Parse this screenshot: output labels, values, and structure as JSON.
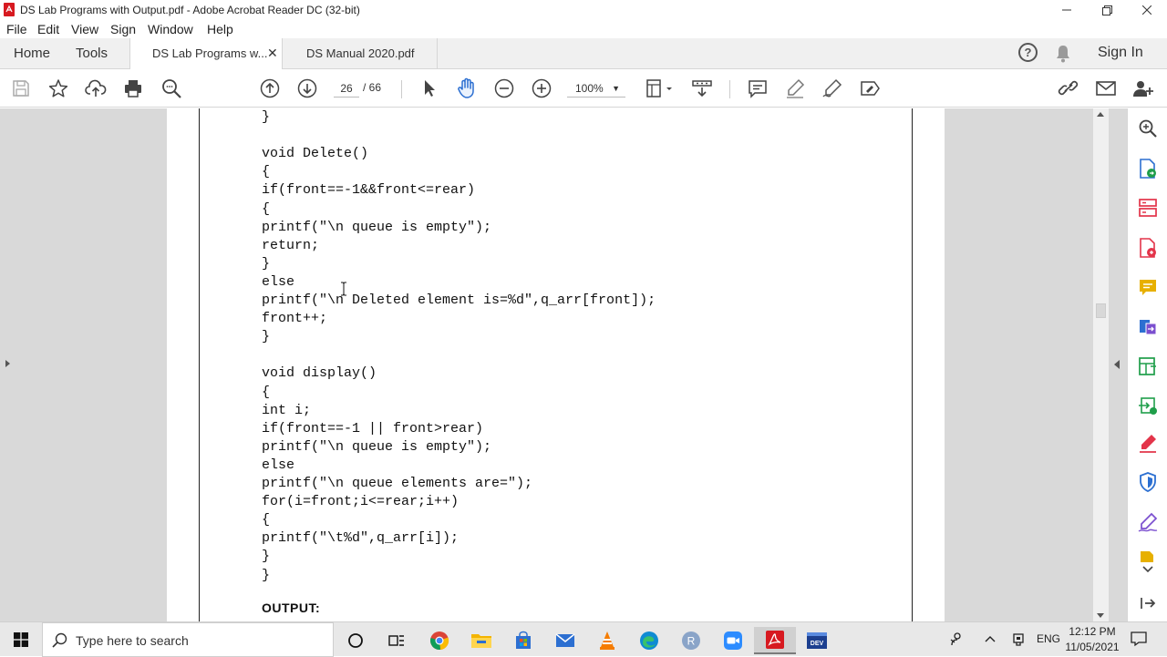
{
  "window": {
    "title": "DS Lab Programs with Output.pdf - Adobe Acrobat Reader DC (32-bit)"
  },
  "menu": [
    "File",
    "Edit",
    "View",
    "Sign",
    "Window",
    "Help"
  ],
  "tabs": {
    "home": "Home",
    "tools": "Tools",
    "documents": [
      {
        "label": "DS Lab Programs w...",
        "active": true,
        "close": "✕"
      },
      {
        "label": "DS Manual 2020.pdf",
        "active": false
      }
    ],
    "sign_in": "Sign In"
  },
  "toolbar": {
    "current_page": "26",
    "page_total": "/ 66",
    "zoom": "100%"
  },
  "document": {
    "code_lines": [
      "}",
      "",
      "void Delete()",
      "{",
      "if(front==-1&&front<=rear)",
      "{",
      "printf(\"\\n queue is empty\");",
      "return;",
      "}",
      "else",
      "printf(\"\\n Deleted element is=%d\",q_arr[front]);",
      "front++;",
      "}",
      "",
      "void display()",
      "{",
      "int i;",
      "if(front==-1 || front>rear)",
      "printf(\"\\n queue is empty\");",
      "else",
      "printf(\"\\n queue elements are=\");",
      "for(i=front;i<=rear;i++)",
      "{",
      "printf(\"\\t%d\",q_arr[i]);",
      "}",
      "}"
    ],
    "output_heading": "OUTPUT:"
  },
  "taskbar": {
    "search_placeholder": "Type here to search",
    "language": "ENG",
    "time": "12:12 PM",
    "date": "11/05/2021"
  },
  "colors": {
    "acrobat_red": "#d71920",
    "workspace_gray": "#d9d9d9",
    "tool_icon_green": "#1f9e4a",
    "tool_icon_blue": "#2c6fd1",
    "tool_icon_purple": "#7b4fcf",
    "tool_icon_yellow": "#e7b000",
    "tool_icon_pink": "#e3344a"
  }
}
